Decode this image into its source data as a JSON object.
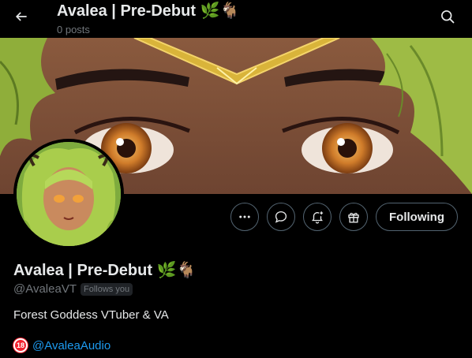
{
  "header": {
    "title": "Avalea | Pre-Debut 🌿🐐",
    "post_count": "0 posts",
    "back_icon": "arrow-left-icon",
    "search_icon": "search-icon"
  },
  "profile": {
    "display_name": "Avalea | Pre-Debut 🌿🐐",
    "handle": "@AvaleaVT",
    "follows_you": "Follows you",
    "bio": "Forest Goddess VTuber & VA",
    "age_badge": "18",
    "link_text": "@AvaleaAudio"
  },
  "actions": {
    "more_icon": "more-horizontal-icon",
    "message_icon": "message-bubble-icon",
    "notify_icon": "bell-plus-icon",
    "gift_icon": "gift-icon",
    "following_label": "Following"
  },
  "colors": {
    "background": "#000000",
    "text_primary": "#e7e9ea",
    "text_secondary": "#71767b",
    "link": "#1d9bf0",
    "border": "#536471",
    "age_badge": "#f4212e"
  }
}
